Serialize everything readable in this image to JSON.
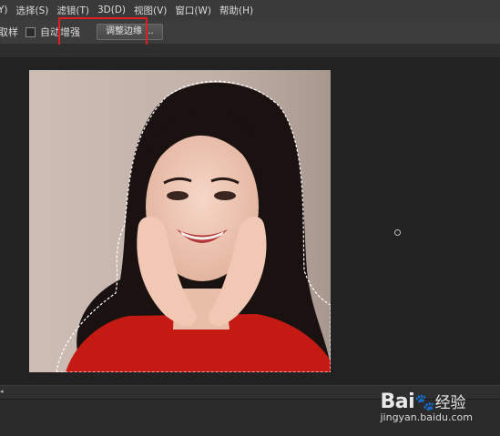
{
  "menubar": {
    "items": [
      "Y)",
      "选择(S)",
      "滤镜(T)",
      "3D(D)",
      "视图(V)",
      "窗口(W)",
      "帮助(H)"
    ]
  },
  "options": {
    "sample_label": "取样",
    "auto_enhance_label": "自动增强",
    "refine_edge_button": "调整边缘 ..."
  },
  "watermark": {
    "logo": "Bai",
    "logo_suffix": "经验",
    "url": "jingyan.baidu.com"
  },
  "colors": {
    "highlight": "#e02020",
    "menubar_bg": "#3a3a3a",
    "canvas_bg": "#222222"
  }
}
